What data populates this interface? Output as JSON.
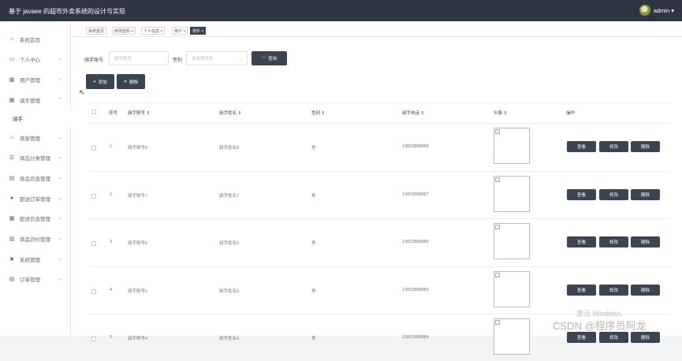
{
  "app": {
    "title": "基于 javaee 的超市外卖系统的设计与实现",
    "user": "admin ▾"
  },
  "sidebar": {
    "items": [
      {
        "label": "系统首页",
        "icon": "home-icon",
        "glyph": "⌂",
        "chevron": ""
      },
      {
        "label": "个人中心",
        "icon": "person-icon",
        "glyph": "▭",
        "chevron": "⌄"
      },
      {
        "label": "用户管理",
        "icon": "grid-icon",
        "glyph": "▦",
        "chevron": "⌄"
      },
      {
        "label": "骑手管理",
        "icon": "grid-icon",
        "glyph": "▦",
        "chevron": "⌃"
      },
      {
        "label": "商家管理",
        "icon": "store-icon",
        "glyph": "⌂",
        "chevron": "⌄"
      },
      {
        "label": "商品分类管理",
        "icon": "list-icon",
        "glyph": "☰",
        "chevron": "⌄"
      },
      {
        "label": "商品信息管理",
        "icon": "list-icon",
        "glyph": "▤",
        "chevron": "⌄"
      },
      {
        "label": "配送订单管理",
        "icon": "location-icon",
        "glyph": "●",
        "chevron": "⌄"
      },
      {
        "label": "配送信息管理",
        "icon": "grid-icon",
        "glyph": "▦",
        "chevron": "⌄"
      },
      {
        "label": "商品评价管理",
        "icon": "chart-icon",
        "glyph": "▥",
        "chevron": "⌄"
      },
      {
        "label": "系统管理",
        "icon": "settings-icon",
        "glyph": "✖",
        "chevron": "⌄"
      },
      {
        "label": "订单管理",
        "icon": "document-icon",
        "glyph": "▤",
        "chevron": "⌄"
      }
    ],
    "sub_item": "骑手"
  },
  "tags": [
    {
      "label": "系统首页"
    },
    {
      "label": "修改密码 ×"
    },
    {
      "label": "个人信息 ×"
    },
    {
      "label": "用户 ×"
    },
    {
      "label": "骑手 ×"
    }
  ],
  "search": {
    "account_label": "骑手账号",
    "account_placeholder": "骑手账号",
    "gender_label": "性别",
    "gender_placeholder": "请选择性别",
    "query_button": "查询"
  },
  "toolbar": {
    "add_button": "添加",
    "delete_button": "删除"
  },
  "table": {
    "headers": [
      "序号",
      "骑手账号 ⇕",
      "骑手姓名 ⇕",
      "性别 ⇕",
      "骑手电话 ⇕",
      "头像 ⇕",
      "操作"
    ],
    "rows": [
      {
        "index": "1",
        "account": "骑手账号8",
        "name": "骑手姓名8",
        "gender": "男",
        "phone": "13823888888"
      },
      {
        "index": "2",
        "account": "骑手账号7",
        "name": "骑手姓名7",
        "gender": "男",
        "phone": "13823888887"
      },
      {
        "index": "3",
        "account": "骑手账号6",
        "name": "骑手姓名6",
        "gender": "男",
        "phone": "13823888886"
      },
      {
        "index": "4",
        "account": "骑手账号5",
        "name": "骑手姓名5",
        "gender": "男",
        "phone": "13823888885"
      },
      {
        "index": "5",
        "account": "骑手账号4",
        "name": "骑手姓名4",
        "gender": "男",
        "phone": "13823888884"
      }
    ],
    "actions": {
      "view": "查看",
      "edit": "修改",
      "delete": "删除"
    }
  },
  "watermarks": {
    "windows": "激活 Windows",
    "csdn": "CSDN @程序员阿龙"
  },
  "colors": {
    "topbar": "#2f3542",
    "button": "#3b4451",
    "background": "#f2f3f5"
  }
}
